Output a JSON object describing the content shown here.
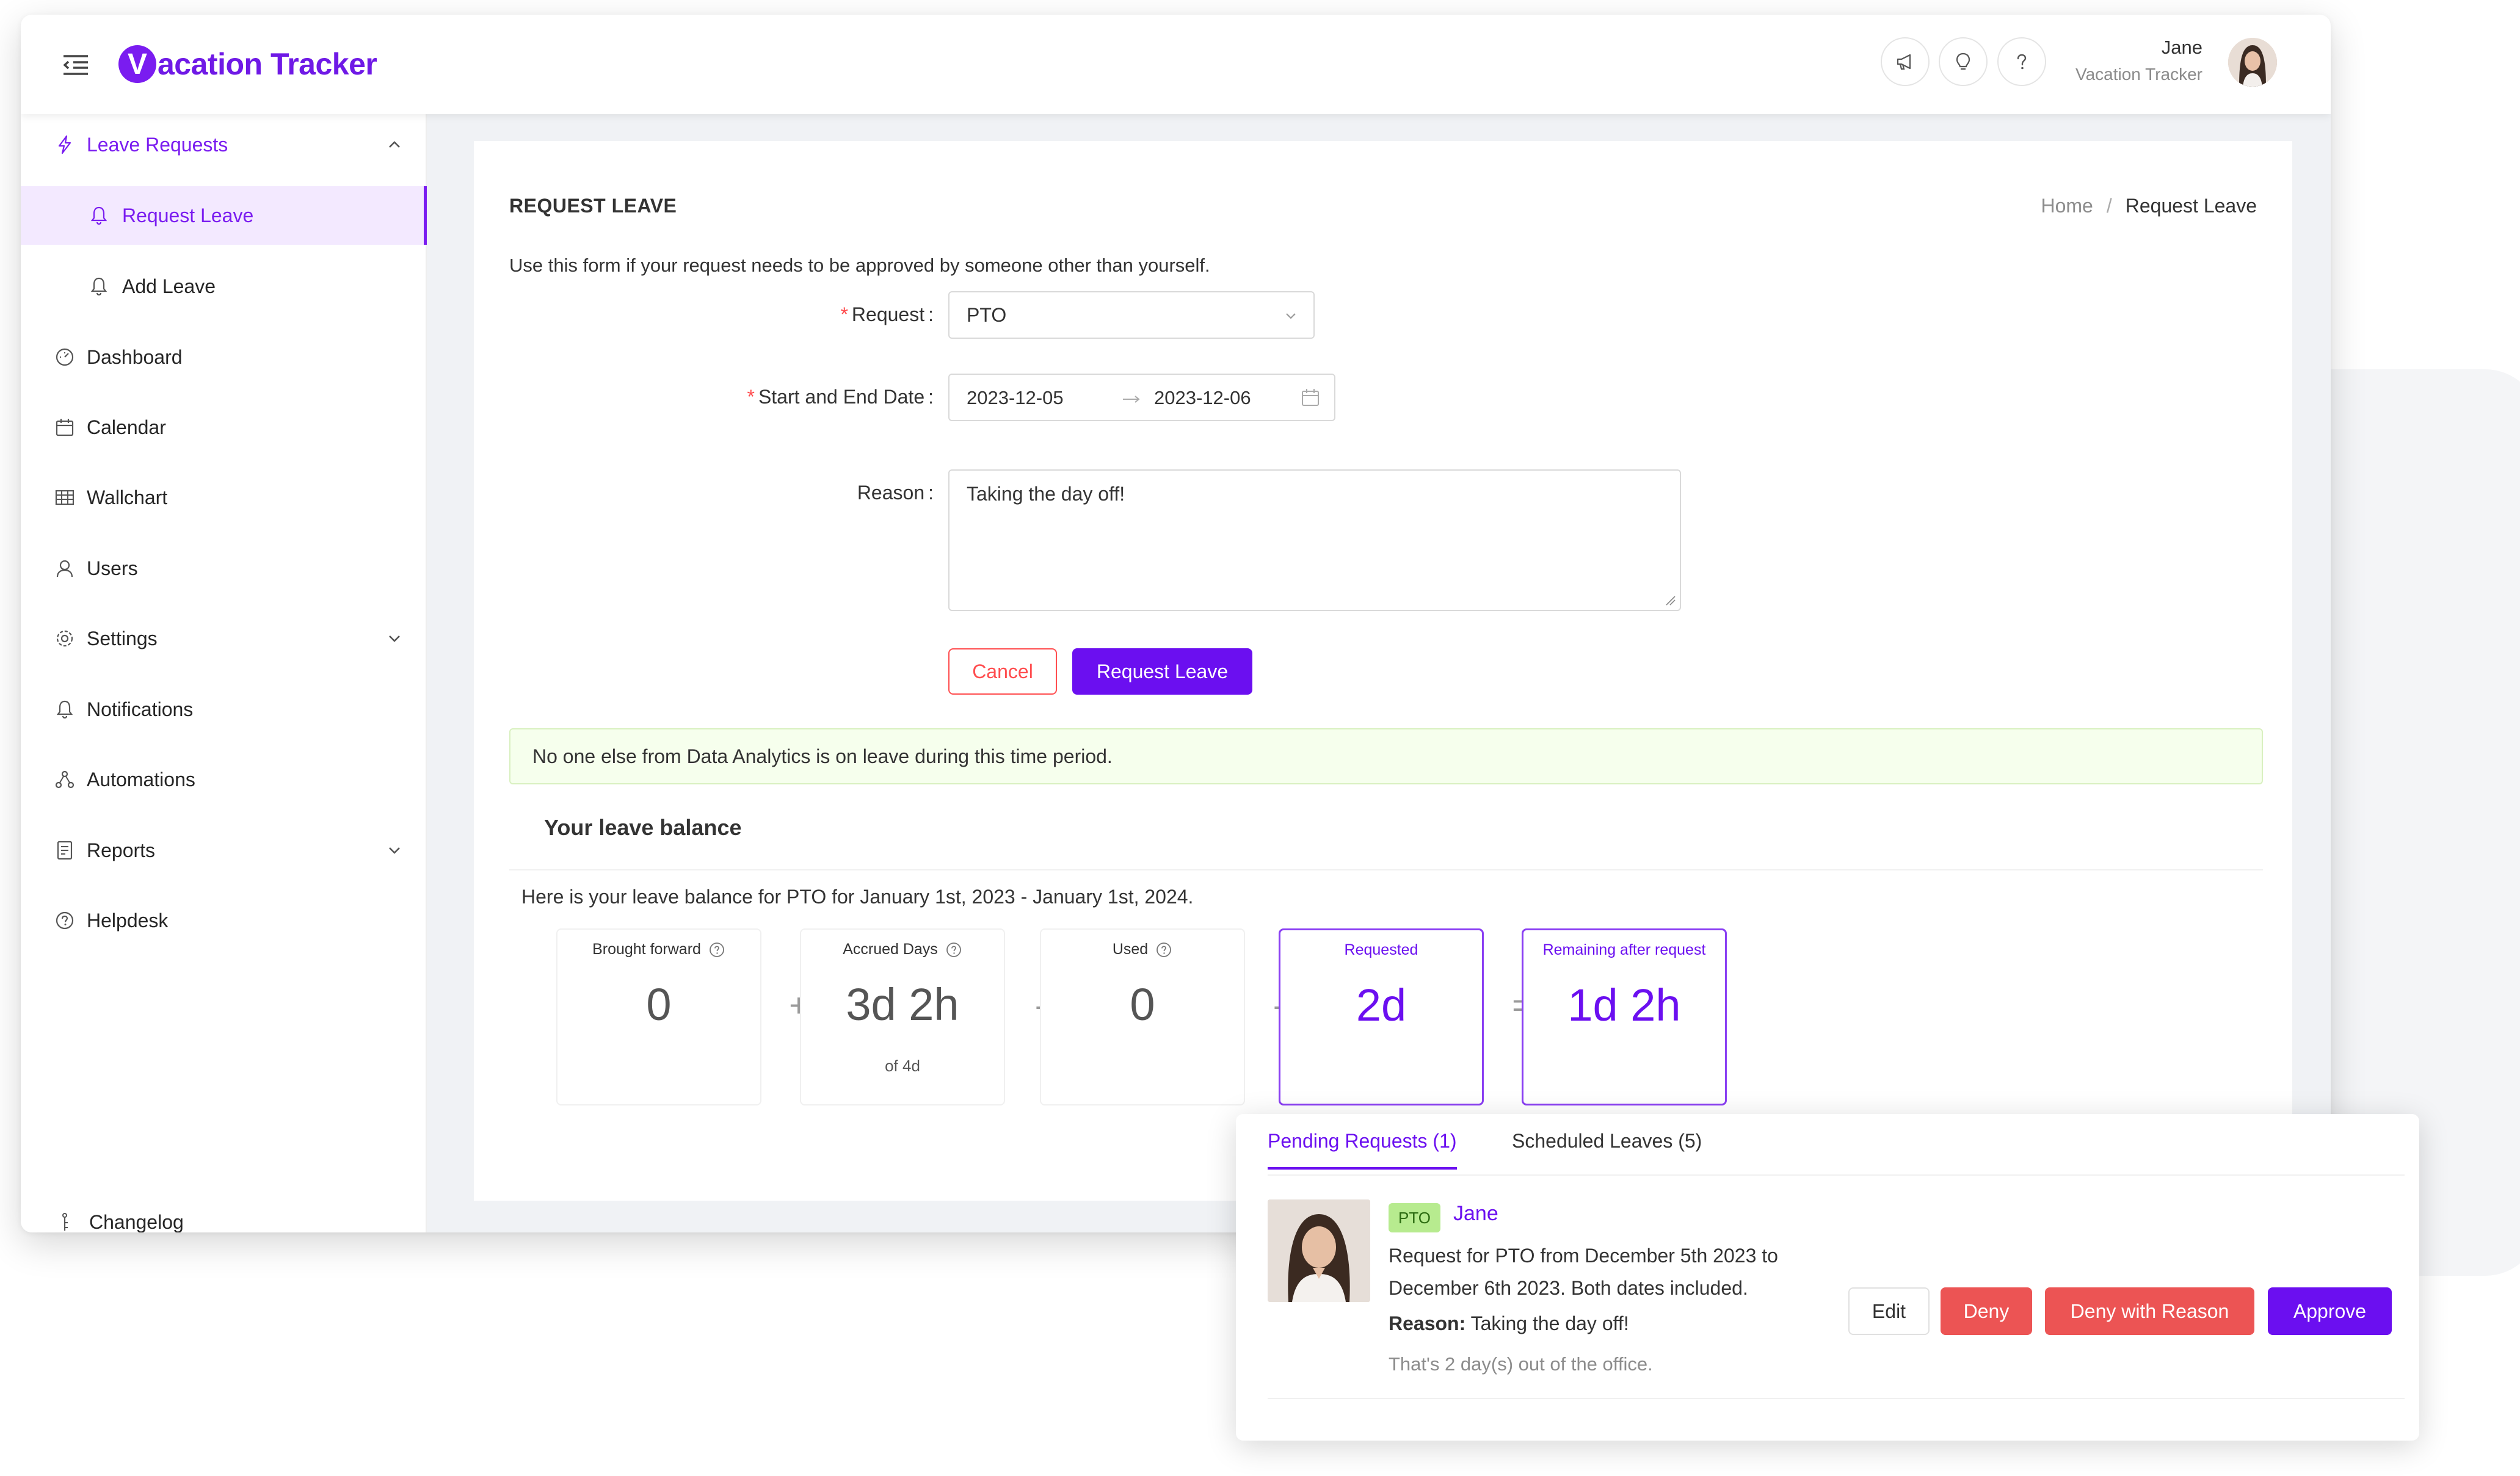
{
  "header": {
    "logo_letter": "V",
    "logo_text": "acation Tracker",
    "user_name": "Jane",
    "user_org": "Vacation Tracker"
  },
  "sidebar": {
    "items": [
      {
        "label": "Leave Requests",
        "icon": "lightning-icon"
      },
      {
        "label": "Request Leave",
        "icon": "bell-icon"
      },
      {
        "label": "Add Leave",
        "icon": "bell-plus-icon"
      },
      {
        "label": "Dashboard",
        "icon": "dashboard-icon"
      },
      {
        "label": "Calendar",
        "icon": "calendar-icon"
      },
      {
        "label": "Wallchart",
        "icon": "table-icon"
      },
      {
        "label": "Users",
        "icon": "user-icon"
      },
      {
        "label": "Settings",
        "icon": "gear-icon"
      },
      {
        "label": "Notifications",
        "icon": "bell-icon"
      },
      {
        "label": "Automations",
        "icon": "automation-icon"
      },
      {
        "label": "Reports",
        "icon": "report-icon"
      },
      {
        "label": "Helpdesk",
        "icon": "help-icon"
      },
      {
        "label": "Changelog",
        "icon": "changelog-icon"
      }
    ]
  },
  "page": {
    "title": "REQUEST LEAVE",
    "breadcrumb": {
      "home": "Home",
      "separator": "/",
      "current": "Request Leave"
    },
    "intro": "Use this form if your request needs to be approved by someone other than yourself."
  },
  "form": {
    "request_label": "Request",
    "request_value": "PTO",
    "dates_label": "Start and End Date",
    "start_date": "2023-12-05",
    "end_date": "2023-12-06",
    "reason_label": "Reason",
    "reason_value": "Taking the day off!",
    "colon": ":",
    "required_mark": "*",
    "cancel_label": "Cancel",
    "submit_label": "Request Leave"
  },
  "alert": {
    "text": "No one else from Data Analytics is on leave during this time period."
  },
  "balance": {
    "title": "Your leave balance",
    "description": "Here is your leave balance for PTO for January 1st, 2023 - January 1st, 2024.",
    "cards": [
      {
        "title": "Brought forward",
        "value": "0",
        "sub": ""
      },
      {
        "title": "Accrued Days",
        "value": "3d 2h",
        "sub": "of 4d"
      },
      {
        "title": "Used",
        "value": "0",
        "sub": ""
      },
      {
        "title": "Requested",
        "value": "2d",
        "sub": ""
      },
      {
        "title": "Remaining after request",
        "value": "1d 2h",
        "sub": ""
      }
    ],
    "operators": [
      "+",
      "-",
      "-",
      "="
    ]
  },
  "popup": {
    "tabs": [
      {
        "label": "Pending Requests (1)"
      },
      {
        "label": "Scheduled Leaves (5)"
      }
    ],
    "request": {
      "badge": "PTO",
      "name": "Jane",
      "description": "Request for PTO from December 5th 2023 to December 6th 2023. Both dates included.",
      "reason_label": "Reason:",
      "reason_value": "Taking the day off!",
      "note": "That's 2 day(s) out of the office."
    },
    "buttons": {
      "edit": "Edit",
      "deny": "Deny",
      "deny_with_reason": "Deny with Reason",
      "approve": "Approve"
    }
  },
  "colors": {
    "brand": "#6b0ff0",
    "danger": "#ec5454",
    "success_bg": "#f6ffed",
    "badge_bg": "#b7eb8f"
  }
}
